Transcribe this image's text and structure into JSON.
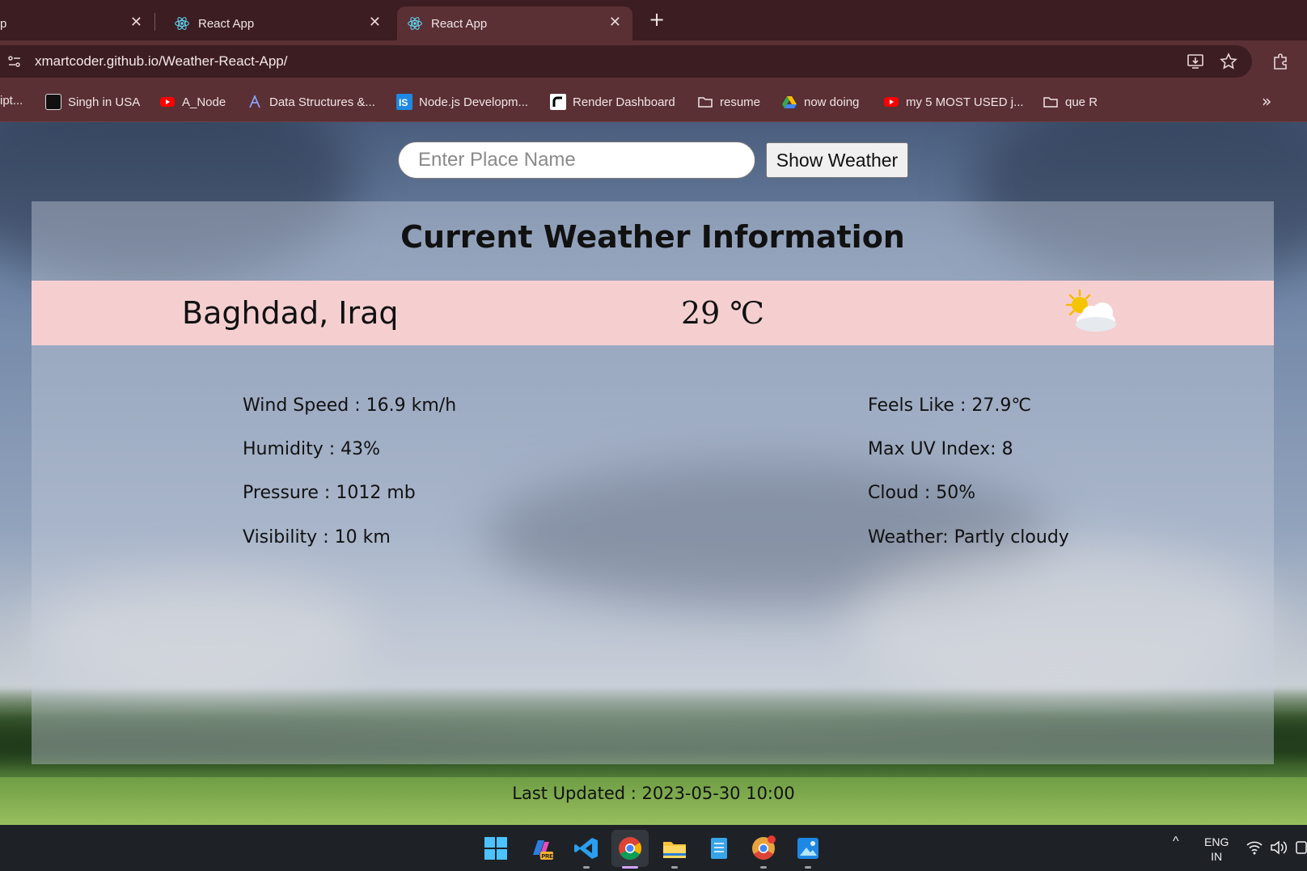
{
  "browser": {
    "tabs": [
      {
        "title": "p",
        "close": "✕"
      },
      {
        "title": "React App",
        "close": "✕"
      },
      {
        "title": "React App",
        "close": "✕",
        "active": true
      }
    ],
    "new_tab": "+",
    "url": "xmartcoder.github.io/Weather-React-App/",
    "bookmarks": [
      {
        "label": "ipt...",
        "icon": "none"
      },
      {
        "label": "Singh in USA",
        "icon": "channel-avatar-icon"
      },
      {
        "label": "A_Node",
        "icon": "youtube-icon"
      },
      {
        "label": "Data Structures &...",
        "icon": "course-icon"
      },
      {
        "label": "Node.js Developm...",
        "icon": "is-icon"
      },
      {
        "label": "Render Dashboard",
        "icon": "render-icon"
      },
      {
        "label": "resume",
        "icon": "folder-icon"
      },
      {
        "label": "now doing",
        "icon": "drive-icon"
      },
      {
        "label": "my 5 MOST USED j...",
        "icon": "youtube-icon"
      },
      {
        "label": "que R",
        "icon": "folder-icon"
      }
    ],
    "more": "»"
  },
  "search": {
    "placeholder": "Enter Place Name",
    "value": "",
    "button_label": "Show Weather"
  },
  "weather": {
    "title": "Current Weather Information",
    "location": "Baghdad, Iraq",
    "temperature": "29 ℃",
    "condition_icon": "partly-cloudy-icon",
    "left_details": [
      "Wind Speed : 16.9 km/h",
      "Humidity : 43%",
      "Pressure : 1012 mb",
      "Visibility : 10 km"
    ],
    "right_details": [
      "Feels Like : 27.9℃",
      "Max UV Index: 8",
      "Cloud : 50%",
      "Weather: Partly cloudy"
    ],
    "last_updated": "Last Updated : 2023-05-30 10:00"
  },
  "taskbar": {
    "apps": [
      "windows-start-icon",
      "copilot-icon",
      "vscode-icon",
      "chrome-icon",
      "file-explorer-icon",
      "notepad-icon",
      "chrome-canary-icon",
      "photos-icon"
    ],
    "tray_chevron": "^",
    "language": "ENG",
    "region": "IN"
  },
  "colors": {
    "tabstrip": "#3c1d21",
    "toolbar": "#5a3034",
    "summary_band": "#f5cfd0",
    "taskbar": "#1e2227"
  }
}
